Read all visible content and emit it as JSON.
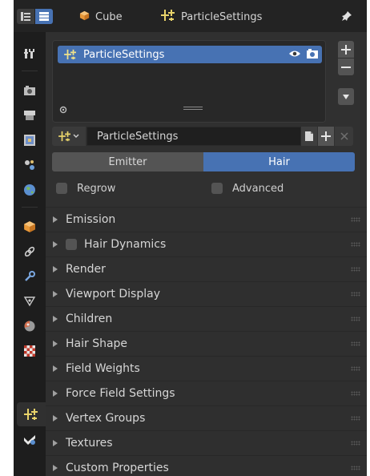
{
  "header": {
    "object_name": "Cube",
    "settings_name": "ParticleSettings",
    "icons": [
      "properties-editor-icon",
      "outliner-icon",
      "cube-object-icon",
      "particle-icon",
      "pin-icon"
    ]
  },
  "sidebar_tabs": [
    "tool-icon",
    "render-icon",
    "output-icon",
    "view-layer-icon",
    "scene-icon",
    "world-icon",
    "object-icon",
    "constraints-icon",
    "modifier-icon",
    "physics-field-icon",
    "material-icon",
    "texture-icon",
    "particles-icon",
    "data-icon"
  ],
  "active_tab": "particles-icon",
  "particle_list": {
    "items": [
      {
        "name": "ParticleSettings",
        "selected": true
      }
    ]
  },
  "datablock": {
    "name": "ParticleSettings"
  },
  "type_tabs": {
    "emitter": "Emitter",
    "hair": "Hair",
    "active": "Hair"
  },
  "options": {
    "regrow": {
      "label": "Regrow",
      "checked": false
    },
    "advanced": {
      "label": "Advanced",
      "checked": false
    }
  },
  "panels": [
    {
      "label": "Emission"
    },
    {
      "label": "Hair Dynamics",
      "checkbox": true
    },
    {
      "label": "Render"
    },
    {
      "label": "Viewport Display"
    },
    {
      "label": "Children"
    },
    {
      "label": "Hair Shape"
    },
    {
      "label": "Field Weights"
    },
    {
      "label": "Force Field Settings"
    },
    {
      "label": "Vertex Groups"
    },
    {
      "label": "Textures"
    },
    {
      "label": "Custom Properties"
    }
  ],
  "colors": {
    "accent": "#4772b3",
    "panel_bg": "#303030",
    "tab_strip_bg": "#1d1d1d"
  }
}
